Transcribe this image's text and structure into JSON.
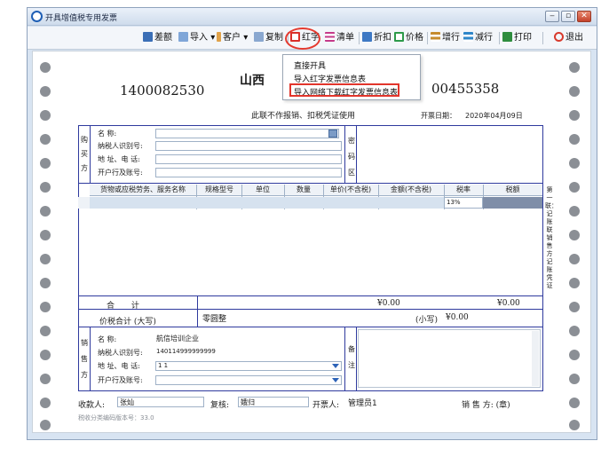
{
  "window": {
    "title": "开具增值税专用发票",
    "icon": "app-icon"
  },
  "toolbar": {
    "items": [
      {
        "id": "cha-e",
        "label": "差额",
        "icon": "calculator-icon",
        "color": "#3b6fb6"
      },
      {
        "id": "daoru",
        "label": "导入",
        "icon": "import-icon",
        "color": "#4a7fc1",
        "dropdown": "▾"
      },
      {
        "id": "kehu",
        "label": "客户",
        "icon": "customer-icon",
        "color": "#d08b2c",
        "dropdown": "▾"
      },
      {
        "id": "fuzhi",
        "label": "复制",
        "icon": "copy-icon",
        "color": "#5a7fb0"
      },
      {
        "id": "hongzi",
        "label": "红字",
        "icon": "red-invoice-icon",
        "color": "#d9302a"
      },
      {
        "id": "qingdan",
        "label": "清单",
        "icon": "list-icon",
        "color": "#c53a8a"
      },
      {
        "id": "zhekou",
        "label": "折扣",
        "icon": "discount-icon",
        "color": "#3d78c4"
      },
      {
        "id": "jiage",
        "label": "价格",
        "icon": "price-icon",
        "color": "#2d9a4a"
      },
      {
        "id": "zenghang",
        "label": "增行",
        "icon": "add-row-icon",
        "color": "#c58b2d"
      },
      {
        "id": "jianhang",
        "label": "减行",
        "icon": "remove-row-icon",
        "color": "#2e86c9"
      },
      {
        "id": "dayin",
        "label": "打印",
        "icon": "printer-icon",
        "color": "#2e8d3e"
      },
      {
        "id": "tuichu",
        "label": "退出",
        "icon": "power-icon",
        "color": "#d83a2c"
      }
    ]
  },
  "dropdown_menu": {
    "items": [
      {
        "label": "直接开具",
        "highlighted": false
      },
      {
        "label": "导入红字发票信息表",
        "highlighted": false
      },
      {
        "label": "导入网络下载红字发票信息表",
        "highlighted": true
      }
    ],
    "highlight_color": "#e2352b"
  },
  "invoice": {
    "code": "1400082530",
    "title_partial": "山西",
    "number": "00455358",
    "notice": "此联不作报销、扣税凭证使用",
    "date_label": "开票日期：",
    "date_value": "2020年04月09日",
    "buyer": {
      "section_label": "购买方",
      "name_label": "名 称:",
      "tax_id_label": "纳税人识别号:",
      "address_label": "地 址、电 话:",
      "bank_label": "开户行及账号:",
      "password_label": "密码区"
    },
    "table": {
      "headers": [
        "货物或应税劳务、服务名称",
        "规格型号",
        "单位",
        "数量",
        "单价(不含税)",
        "金额(不含税)",
        "税率",
        "税额"
      ],
      "row1_tax_rate": "13%"
    },
    "totals": {
      "label": "合 计",
      "amount": "¥0.00",
      "tax": "¥0.00"
    },
    "total_with_tax": {
      "label": "价税合计 (大写)",
      "upper_value": "零圆整",
      "lower_label": "(小写)",
      "lower_value": "¥0.00"
    },
    "seller": {
      "section_label": "销售方",
      "name_label": "名 称:",
      "name_value": "航信培训企业",
      "tax_id_label": "纳税人识别号:",
      "tax_id_value": "140114999999999",
      "address_label": "地 址、电 话:",
      "address_value": "1 1",
      "bank_label": "开户行及账号:",
      "remarks_label": "备注"
    },
    "side_label": "第一联：记账联 销售方记账凭证",
    "footer": {
      "payee_label": "收款人:",
      "payee_value": "张灿",
      "reviewer_label": "复核:",
      "reviewer_value": "娥归",
      "issuer_label": "开票人:",
      "issuer_value": "管理员1",
      "seller_label": "销 售 方: (章)",
      "version_text": "税收分类编码版本号：33.0"
    }
  }
}
